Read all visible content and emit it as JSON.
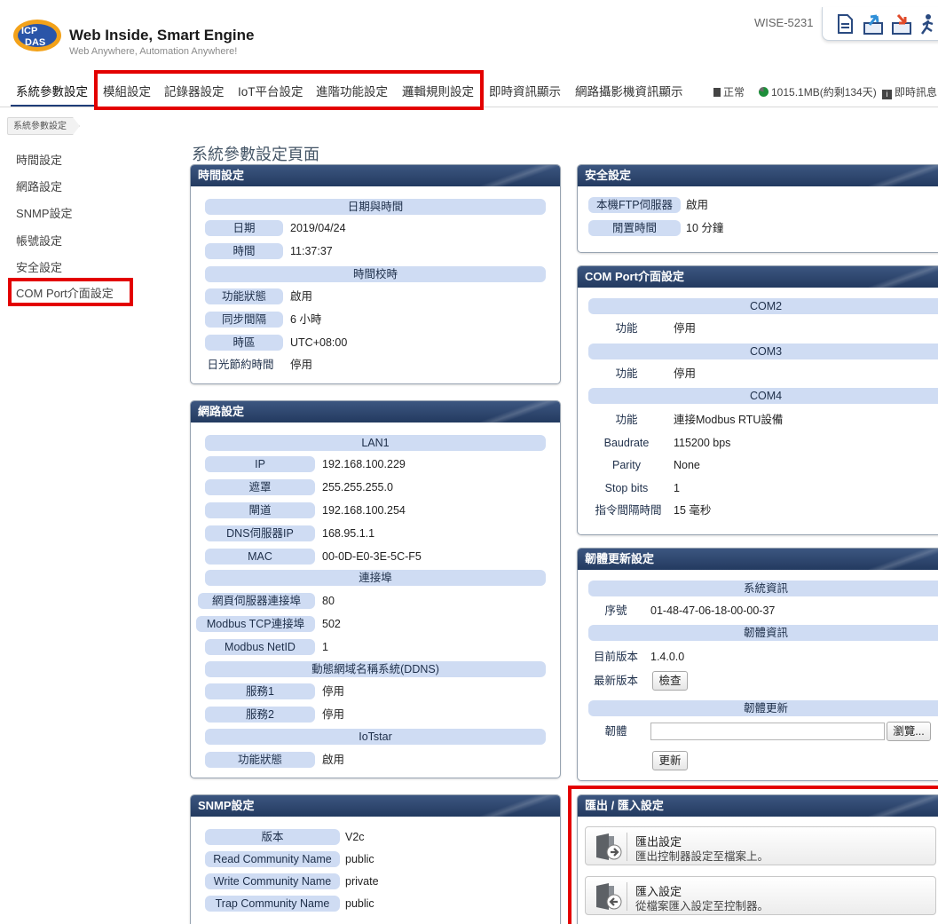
{
  "header": {
    "brand_title": "Web Inside, Smart Engine",
    "brand_sub": "Web Anywhere, Automation Anywhere!",
    "model": "WISE-5231",
    "status_normal": "正常",
    "memory": "1015.1MB(約剩134天)",
    "realtime_info": "即時訊息",
    "icons": [
      "document-icon",
      "upload-icon",
      "download-icon",
      "logout-icon"
    ]
  },
  "nav": [
    "系統參數設定",
    "模組設定",
    "記錄器設定",
    "IoT平台設定",
    "進階功能設定",
    "邏輯規則設定",
    "即時資訊顯示",
    "網路攝影機資訊顯示"
  ],
  "breadcrumb": "系統參數設定",
  "sidebar": [
    "時間設定",
    "網路設定",
    "SNMP設定",
    "帳號設定",
    "安全設定",
    "COM Port介面設定"
  ],
  "page_title": "系統參數設定頁面",
  "time_panel": {
    "title": "時間設定",
    "band1": "日期與時間",
    "date_label": "日期",
    "date_value": "2019/04/24",
    "time_label": "時間",
    "time_value": "11:37:37",
    "band2": "時間校時",
    "func_label": "功能狀態",
    "func_value": "啟用",
    "sync_label": "同步間隔",
    "sync_value": "6 小時",
    "tz_label": "時區",
    "tz_value": "UTC+08:00",
    "dst_label": "日光節約時間",
    "dst_value": "停用"
  },
  "network_panel": {
    "title": "網路設定",
    "band_lan": "LAN1",
    "ip_label": "IP",
    "ip_value": "192.168.100.229",
    "mask_label": "遮罩",
    "mask_value": "255.255.255.0",
    "gw_label": "閘道",
    "gw_value": "192.168.100.254",
    "dns_label": "DNS伺服器IP",
    "dns_value": "168.95.1.1",
    "mac_label": "MAC",
    "mac_value": "00-0D-E0-3E-5C-F5",
    "band_port": "連接埠",
    "web_label": "網頁伺服器連接埠",
    "web_value": "80",
    "mtcp_label": "Modbus TCP連接埠",
    "mtcp_value": "502",
    "mid_label": "Modbus NetID",
    "mid_value": "1",
    "band_ddns": "動態網域名稱系統(DDNS)",
    "s1_label": "服務1",
    "s1_value": "停用",
    "s2_label": "服務2",
    "s2_value": "停用",
    "band_iot": "IoTstar",
    "iot_label": "功能狀態",
    "iot_value": "啟用"
  },
  "snmp_panel": {
    "title": "SNMP設定",
    "ver_label": "版本",
    "ver_value": "V2c",
    "read_label": "Read Community Name",
    "read_value": "public",
    "write_label": "Write Community Name",
    "write_value": "private",
    "trap_label": "Trap Community Name",
    "trap_value": "public"
  },
  "security_panel": {
    "title": "安全設定",
    "ftp_label": "本機FTP伺服器",
    "ftp_value": "啟用",
    "idle_label": "閒置時間",
    "idle_value": "10 分鐘"
  },
  "com_panel": {
    "title": "COM Port介面設定",
    "com2": "COM2",
    "com2_func_label": "功能",
    "com2_func_value": "停用",
    "com3": "COM3",
    "com3_func_label": "功能",
    "com3_func_value": "停用",
    "com4": "COM4",
    "com4_func_label": "功能",
    "com4_func_value": "連接Modbus RTU設備",
    "baud_label": "Baudrate",
    "baud_value": "115200 bps",
    "parity_label": "Parity",
    "parity_value": "None",
    "stop_label": "Stop bits",
    "stop_value": "1",
    "interval_label": "指令間隔時間",
    "interval_value": "15 毫秒"
  },
  "firmware_panel": {
    "title": "韌體更新設定",
    "band_sys": "系統資訊",
    "serial_label": "序號",
    "serial_value": "01-48-47-06-18-00-00-37",
    "band_fw": "韌體資訊",
    "cur_label": "目前版本",
    "cur_value": "1.4.0.0",
    "latest_label": "最新版本",
    "check_button": "檢查",
    "band_update": "韌體更新",
    "fw_label": "韌體",
    "browse_button": "瀏覽...",
    "update_button": "更新"
  },
  "io_panel": {
    "title": "匯出 / 匯入設定",
    "export_title": "匯出設定",
    "export_desc": "匯出控制器設定至檔案上。",
    "import_title": "匯入設定",
    "import_desc": "從檔案匯入設定至控制器。"
  },
  "colors": {
    "highlight": "#e30000",
    "panel_header": "#2d4670",
    "band": "#cfdcf3"
  }
}
